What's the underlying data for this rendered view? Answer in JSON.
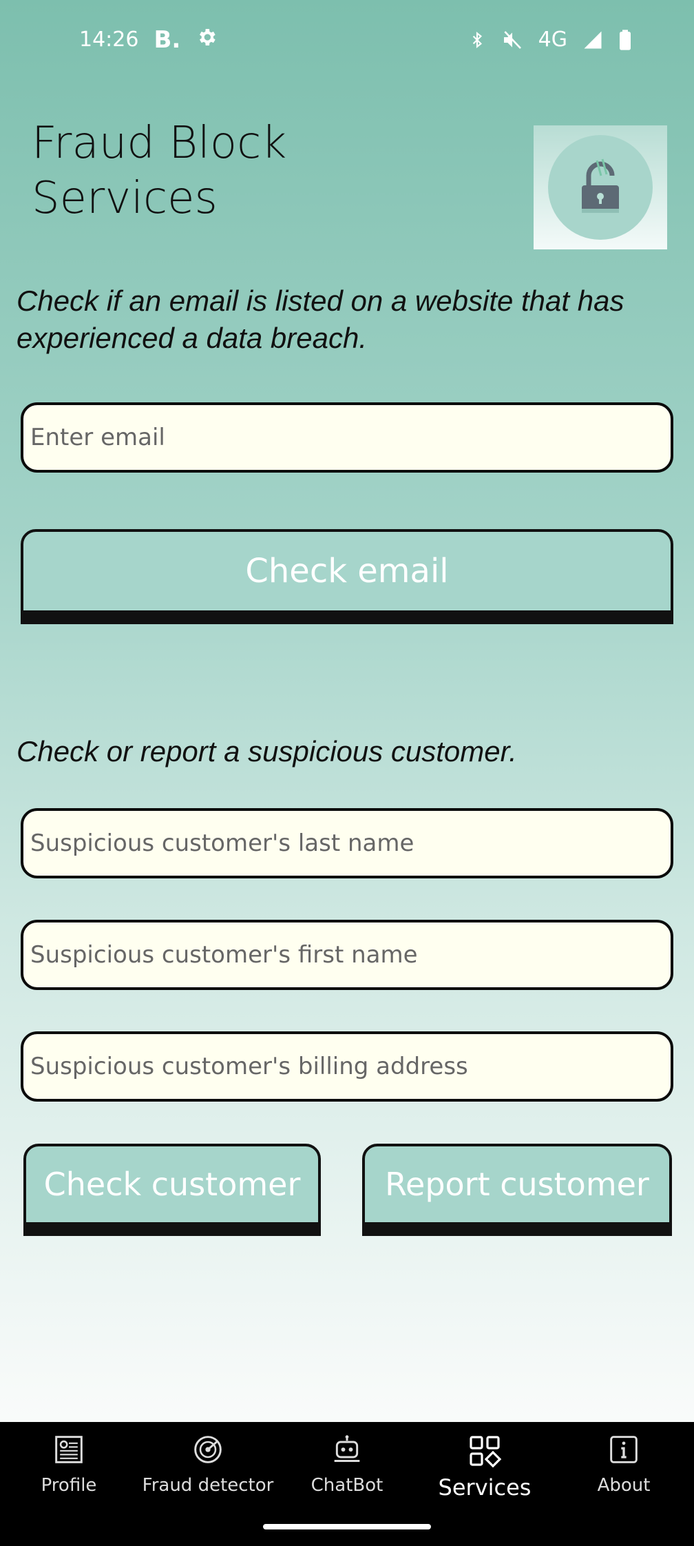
{
  "status": {
    "time": "14:26",
    "network": "4G"
  },
  "title_line1": "Fraud Block",
  "title_line2": "Services",
  "email_section": {
    "description": "Check if an email is listed on a website that has experienced a data breach.",
    "email_placeholder": "Enter email",
    "check_label": "Check email"
  },
  "customer_section": {
    "description": "Check or report a suspicious customer.",
    "last_name_placeholder": "Suspicious customer's last name",
    "first_name_placeholder": "Suspicious customer's first name",
    "address_placeholder": "Suspicious customer's billing address",
    "check_label": "Check customer",
    "report_label": "Report customer"
  },
  "nav": {
    "items": [
      {
        "label": "Profile",
        "icon": "profile-icon"
      },
      {
        "label": "Fraud detector",
        "icon": "radar-icon"
      },
      {
        "label": "ChatBot",
        "icon": "robot-icon"
      },
      {
        "label": "Services",
        "icon": "services-icon"
      },
      {
        "label": "About",
        "icon": "info-icon"
      }
    ],
    "active": "Services"
  }
}
